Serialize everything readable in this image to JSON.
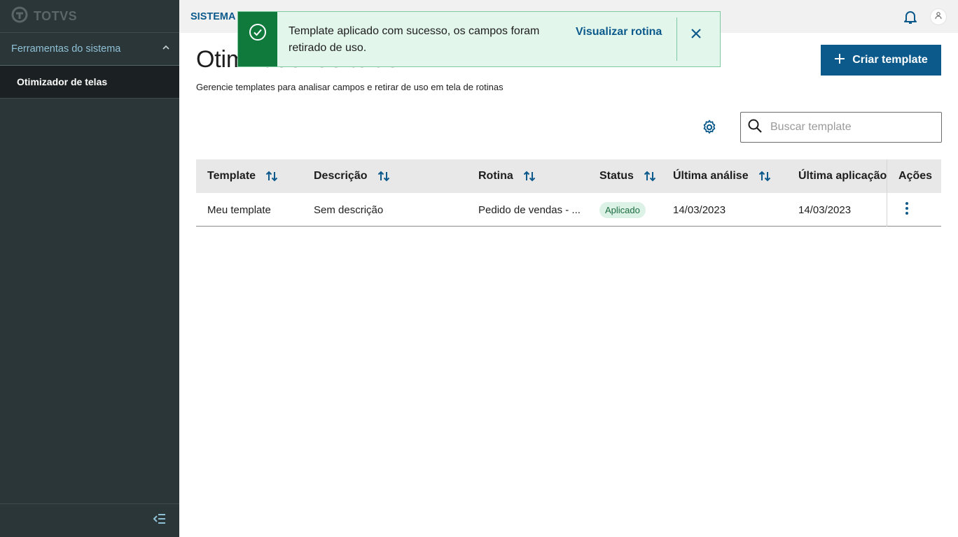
{
  "sidebar": {
    "logo_text": "TOTVS",
    "group_label": "Ferramentas do sistema",
    "items": [
      {
        "label": "Otimizador de telas"
      }
    ]
  },
  "topbar": {
    "system_title": "SISTEMA D"
  },
  "page": {
    "title": "Otimizador de telas",
    "subtitle": "Gerencie templates para analisar campos e retirar de uso em tela de rotinas",
    "create_button": "Criar template",
    "search_placeholder": "Buscar template"
  },
  "table": {
    "columns": [
      "Template",
      "Descrição",
      "Rotina",
      "Status",
      "Última análise",
      "Última aplicação",
      "Ações"
    ],
    "rows": [
      {
        "template": "Meu template",
        "descricao": "Sem descrição",
        "rotina": "Pedido de vendas - ...",
        "status": "Aplicado",
        "ultima_analise": "14/03/2023",
        "ultima_aplicacao": "14/03/2023"
      }
    ]
  },
  "toast": {
    "message": "Template aplicado com sucesso, os campos foram retirado de uso.",
    "action": "Visualizar rotina"
  },
  "icons": [
    "totvs-logo-icon",
    "chevron-up-icon",
    "collapse-menu-icon",
    "bell-icon",
    "user-icon",
    "plus-icon",
    "gear-icon",
    "search-icon",
    "sort-icon",
    "more-vertical-icon",
    "check-circle-icon",
    "close-icon"
  ],
  "colors": {
    "primary": "#0c5a8c",
    "sidebar_bg": "#2b3638",
    "success": "#0f7a3c",
    "success_bg": "#e3f6ec"
  }
}
